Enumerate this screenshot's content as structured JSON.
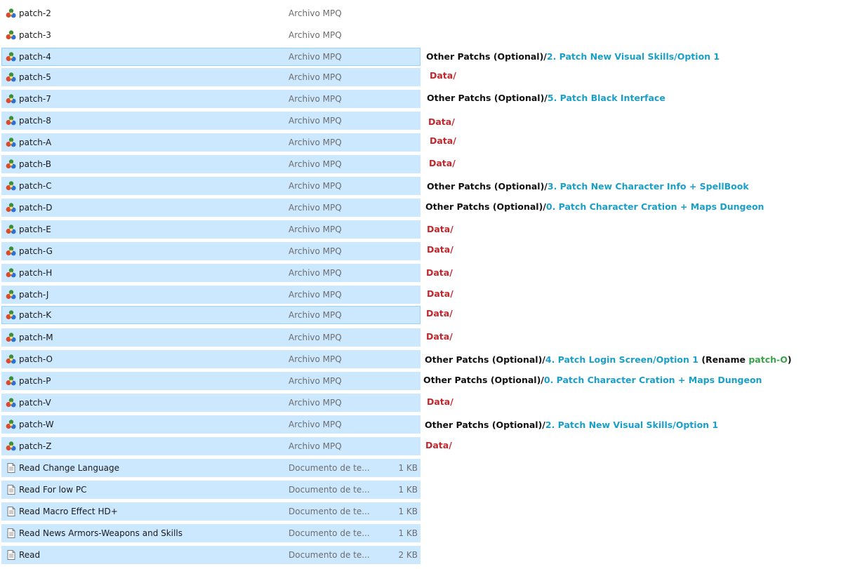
{
  "files": [
    {
      "name": "patch-2",
      "type": "Archivo MPQ",
      "size": "",
      "icon": "mpq-file-icon",
      "selected": false
    },
    {
      "name": "patch-3",
      "type": "Archivo MPQ",
      "size": "",
      "icon": "mpq-file-icon",
      "selected": false
    },
    {
      "name": "patch-4",
      "type": "Archivo MPQ",
      "size": "",
      "icon": "mpq-file-icon",
      "selected": true
    },
    {
      "name": "patch-5",
      "type": "Archivo MPQ",
      "size": "",
      "icon": "mpq-file-icon",
      "selected": true
    },
    {
      "name": "patch-7",
      "type": "Archivo MPQ",
      "size": "",
      "icon": "mpq-file-icon",
      "selected": true
    },
    {
      "name": "patch-8",
      "type": "Archivo MPQ",
      "size": "",
      "icon": "mpq-file-icon",
      "selected": true
    },
    {
      "name": "patch-A",
      "type": "Archivo MPQ",
      "size": "",
      "icon": "mpq-file-icon",
      "selected": true
    },
    {
      "name": "patch-B",
      "type": "Archivo MPQ",
      "size": "",
      "icon": "mpq-file-icon",
      "selected": true
    },
    {
      "name": "patch-C",
      "type": "Archivo MPQ",
      "size": "",
      "icon": "mpq-file-icon",
      "selected": true
    },
    {
      "name": "patch-D",
      "type": "Archivo MPQ",
      "size": "",
      "icon": "mpq-file-icon",
      "selected": true
    },
    {
      "name": "patch-E",
      "type": "Archivo MPQ",
      "size": "",
      "icon": "mpq-file-icon",
      "selected": true
    },
    {
      "name": "patch-G",
      "type": "Archivo MPQ",
      "size": "",
      "icon": "mpq-file-icon",
      "selected": true
    },
    {
      "name": "patch-H",
      "type": "Archivo MPQ",
      "size": "",
      "icon": "mpq-file-icon",
      "selected": true
    },
    {
      "name": "patch-J",
      "type": "Archivo MPQ",
      "size": "",
      "icon": "mpq-file-icon",
      "selected": true
    },
    {
      "name": "patch-K",
      "type": "Archivo MPQ",
      "size": "",
      "icon": "mpq-file-icon",
      "selected": true
    },
    {
      "name": "patch-M",
      "type": "Archivo MPQ",
      "size": "",
      "icon": "mpq-file-icon",
      "selected": true
    },
    {
      "name": "patch-O",
      "type": "Archivo MPQ",
      "size": "",
      "icon": "mpq-file-icon",
      "selected": true
    },
    {
      "name": "patch-P",
      "type": "Archivo MPQ",
      "size": "",
      "icon": "mpq-file-icon",
      "selected": true
    },
    {
      "name": "patch-V",
      "type": "Archivo MPQ",
      "size": "",
      "icon": "mpq-file-icon",
      "selected": true
    },
    {
      "name": "patch-W",
      "type": "Archivo MPQ",
      "size": "",
      "icon": "mpq-file-icon",
      "selected": true
    },
    {
      "name": "patch-Z",
      "type": "Archivo MPQ",
      "size": "",
      "icon": "mpq-file-icon",
      "selected": true
    },
    {
      "name": "Read Change Language",
      "type": "Documento de te...",
      "size": "1 KB",
      "icon": "text-document-icon",
      "selected": true
    },
    {
      "name": "Read For low PC",
      "type": "Documento de te...",
      "size": "1 KB",
      "icon": "text-document-icon",
      "selected": true
    },
    {
      "name": "Read Macro Effect HD+",
      "type": "Documento de te...",
      "size": "1 KB",
      "icon": "text-document-icon",
      "selected": true
    },
    {
      "name": "Read News Armors-Weapons and Skills",
      "type": "Documento de te...",
      "size": "1 KB",
      "icon": "text-document-icon",
      "selected": true
    },
    {
      "name": "Read",
      "type": "Documento de te...",
      "size": "2 KB",
      "icon": "text-document-icon",
      "selected": true
    }
  ],
  "notes": [
    {
      "parts": [
        {
          "t": "Other Patchs (Optional)/",
          "c": "k"
        },
        {
          "t": "2. Patch New Visual Skills/Option 1",
          "c": "b"
        }
      ]
    },
    {
      "parts": [
        {
          "t": "Data/",
          "c": "r"
        }
      ]
    },
    {
      "parts": [
        {
          "t": "Other Patchs (Optional)/",
          "c": "k"
        },
        {
          "t": "5. Patch Black Interface",
          "c": "b"
        }
      ]
    },
    {
      "parts": [
        {
          "t": "Data/",
          "c": "r"
        }
      ]
    },
    {
      "parts": [
        {
          "t": "Data/",
          "c": "r"
        }
      ]
    },
    {
      "parts": [
        {
          "t": "Data/",
          "c": "r"
        }
      ]
    },
    {
      "parts": [
        {
          "t": "Other Patchs (Optional)/",
          "c": "k"
        },
        {
          "t": "3. Patch New Character Info + SpellBook",
          "c": "b"
        }
      ]
    },
    {
      "parts": [
        {
          "t": "Other Patchs (Optional)/",
          "c": "k"
        },
        {
          "t": "0. Patch Character Cration + Maps Dungeon",
          "c": "b"
        }
      ]
    },
    {
      "parts": [
        {
          "t": "Data/",
          "c": "r"
        }
      ]
    },
    {
      "parts": [
        {
          "t": "Data/",
          "c": "r"
        }
      ]
    },
    {
      "parts": [
        {
          "t": "Data/",
          "c": "r"
        }
      ]
    },
    {
      "parts": [
        {
          "t": "Data/",
          "c": "r"
        }
      ]
    },
    {
      "parts": [
        {
          "t": "Data/",
          "c": "r"
        }
      ]
    },
    {
      "parts": [
        {
          "t": "Data/",
          "c": "r"
        }
      ]
    },
    {
      "parts": [
        {
          "t": "Other Patchs (Optional)/",
          "c": "k"
        },
        {
          "t": "4. Patch Login Screen/Option 1",
          "c": "b"
        },
        {
          "t": " (Rename ",
          "c": "k"
        },
        {
          "t": "patch-O",
          "c": "g"
        },
        {
          "t": ")",
          "c": "k"
        }
      ]
    },
    {
      "parts": [
        {
          "t": "Other Patchs (Optional)/",
          "c": "k"
        },
        {
          "t": "0. Patch Character Cration + Maps Dungeon",
          "c": "b"
        }
      ]
    },
    {
      "parts": [
        {
          "t": "Data/",
          "c": "r"
        }
      ]
    },
    {
      "parts": [
        {
          "t": "Other Patchs (Optional)/",
          "c": "k"
        },
        {
          "t": "2. Patch New Visual Skills/Option 1",
          "c": "b"
        }
      ]
    },
    {
      "parts": [
        {
          "t": "Data/",
          "c": "r"
        }
      ]
    }
  ],
  "colors": {
    "selection": "#cce8ff",
    "focus_border": "#99d1ff",
    "note_blue": "#1a9fc9",
    "note_red": "#c0282d",
    "note_green": "#3aa34a"
  }
}
